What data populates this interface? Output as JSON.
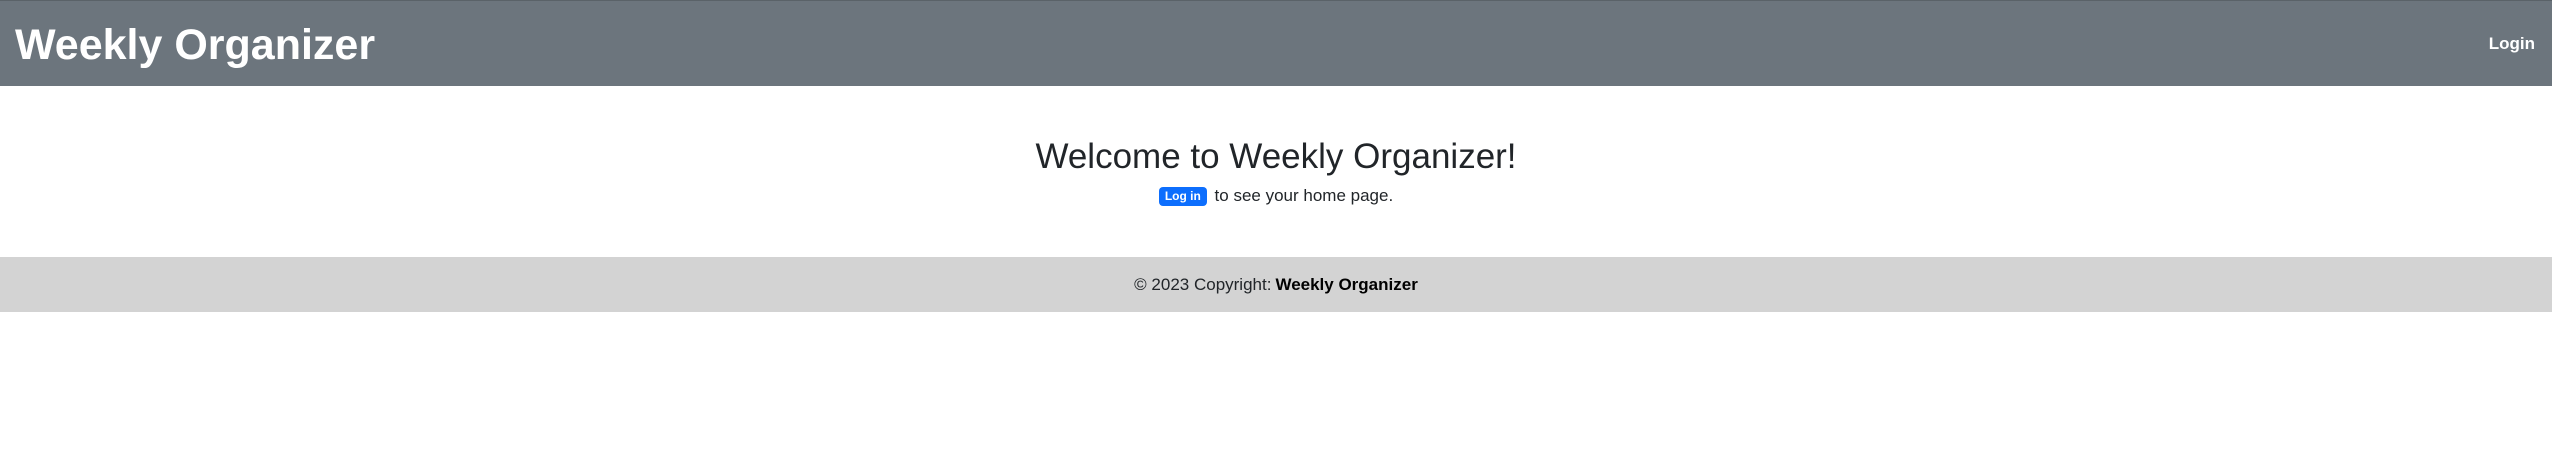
{
  "navbar": {
    "brand": "Weekly Organizer",
    "login_label": "Login"
  },
  "main": {
    "title": "Welcome to Weekly Organizer!",
    "login_badge": "Log in",
    "message": "to see your home page."
  },
  "footer": {
    "copyright": "© 2023 Copyright:",
    "brand": "Weekly Organizer"
  },
  "colors": {
    "navbar_bg": "#6c757d",
    "badge_bg": "#0d6efd",
    "footer_bg": "#d3d3d3"
  }
}
